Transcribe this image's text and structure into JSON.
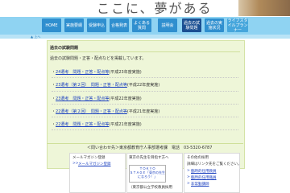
{
  "header": {
    "title": "ここに、夢がある"
  },
  "nav": {
    "items": [
      {
        "label": "HOME"
      },
      {
        "label": "実施要綱"
      },
      {
        "label": "受験申込"
      },
      {
        "label": "合格発表"
      },
      {
        "label": "よくある質問"
      },
      {
        "label": "説明会"
      },
      {
        "label": "過去の試験問題"
      },
      {
        "label": "過去の実施状況"
      },
      {
        "label": "ライフスタイルプランナー"
      }
    ]
  },
  "breadcrumb": {
    "marker": "▲ 上へ"
  },
  "main": {
    "section_title": "過去の試験問題",
    "intro": "過去の試験問題・正答・配点などを掲載しています。",
    "items": [
      {
        "link": "24選考　問題・正答・配点等",
        "note": "(平成23年度実施)"
      },
      {
        "link": "23選考（第２回）　問題・正答・配点等",
        "note": "(平成22年度実施)"
      },
      {
        "link": "23選考　問題・正答・配点等",
        "note": "(平成22年度実施)"
      },
      {
        "link": "22選考（第２回）　問題・正答・配点等",
        "note": "(平成21年度実施)"
      },
      {
        "link": "22選考　問題・正答・配点等",
        "note": "(平成21年度実施)"
      }
    ],
    "contact": "＜問い合わせ先＞東京都教育庁人事部選考課　電話　03-5320-6787"
  },
  "boxes": {
    "mail": {
      "title": "メールマガジン登録",
      "link": "メールマガジン登録"
    },
    "tokyo": {
      "title": "東京の先生を目指す方へ",
      "banner_line1": "ＴＯＫＹＯ",
      "banner_line2": "ＳＴＡＧＥ「東京の先生になろう！」",
      "sub": "（東京都公立学校教員採用"
    },
    "other": {
      "title": "その他の採用",
      "desc": "詳細はリンク先をご覧ください。",
      "links": [
        "臨時的任用教員",
        "臨時的任用職員",
        "非常勤講師"
      ]
    }
  }
}
